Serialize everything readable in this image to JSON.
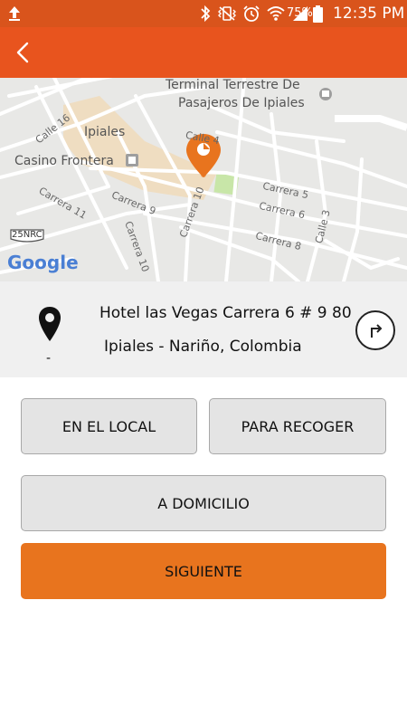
{
  "status_bar": {
    "battery": "75%",
    "time": "12:35 PM"
  },
  "colors": {
    "status_bar": "#d9541c",
    "app_bar": "#e8541e",
    "primary_button": "#e8741e",
    "secondary_button": "#e4e4e4",
    "map_pin": "#e8741e"
  },
  "icons": {
    "upload": "upload-icon",
    "back": "back-arrow-icon",
    "location": "location-pin-icon",
    "route": "route-turn-icon"
  },
  "map": {
    "places": [
      "Terminal Terrestre De",
      "Pasajeros De Ipiales",
      "Ipiales",
      "Casino Frontera"
    ],
    "streets": [
      "Calle 16",
      "Calle 4",
      "Carrera 11",
      "Carrera 9",
      "Carrera 10",
      "Carrera 5",
      "Carrera 6",
      "Carrera 8",
      "Carrera 10",
      "Calle 3"
    ],
    "route_badge": "25NRC",
    "attribution": "Google"
  },
  "address": {
    "line1": "Hotel las Vegas Carrera 6 # 9 80",
    "line2": "Ipiales - Nariño, Colombia",
    "extra": "-"
  },
  "buttons": {
    "en_el_local": "EN EL LOCAL",
    "para_recoger": "PARA RECOGER",
    "a_domicilio": "A DOMICILIO",
    "siguiente": "SIGUIENTE"
  }
}
